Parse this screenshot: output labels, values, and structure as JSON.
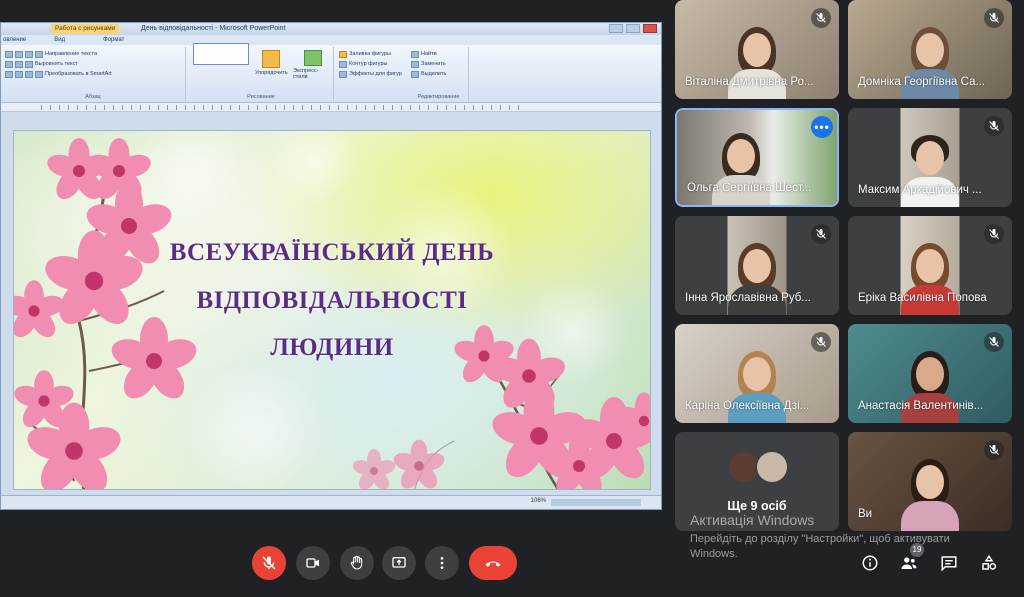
{
  "powerpoint": {
    "window_title": "День відповідальності - Microsoft PowerPoint",
    "context_tab": "Работа с рисунками",
    "tabs": [
      "овление",
      "Вид",
      "Формат"
    ],
    "ribbon": {
      "text_direction": "Направление текста",
      "align_text": "Выровнять текст",
      "smartart": "Преобразовать в SmartArt",
      "arrange": "Упорядочить",
      "quick_styles": "Экспресс-стили",
      "shape_fill": "Заливка фигуры",
      "shape_outline": "Контур фигуры",
      "shape_effects": "Эффекты для фигур",
      "find": "Найти",
      "replace": "Заменить",
      "select": "Выделить",
      "group_paragraph": "Абзац",
      "group_drawing": "Рисование",
      "group_editing": "Редактирование"
    },
    "zoom": "106%",
    "slide_lines": [
      "ВСЕУКРАЇНСЬКИЙ ДЕНЬ",
      "ВІДПОВІДАЛЬНОСТІ",
      "ЛЮДИНИ"
    ]
  },
  "participants": [
    {
      "name": "Віталіна Дмитрівна Ро...",
      "muted": true
    },
    {
      "name": "Домніка Георгіївна Са...",
      "muted": true
    },
    {
      "name": "Ольга Сергіївна Шест...",
      "muted": false,
      "active": true
    },
    {
      "name": "Максим Аркадійович ...",
      "muted": true
    },
    {
      "name": "Інна Ярославівна Руб...",
      "muted": true
    },
    {
      "name": "Еріка Василівна Попова",
      "muted": true
    },
    {
      "name": "Каріна Олексіївна Дзі...",
      "muted": true
    },
    {
      "name": "Анастасія Валентинів...",
      "muted": true
    },
    {
      "name": "Ви",
      "muted": true
    }
  ],
  "others_tile": {
    "label": "Ще 9 осіб"
  },
  "activation": {
    "title": "Активація Windows",
    "line1": "Перейдіть до розділу \"Настройки\", щоб активувати",
    "line2": "Windows."
  },
  "toolbar": {
    "mic": "mic-off-icon",
    "camera": "camera-icon",
    "raise_hand": "hand-icon",
    "present": "present-icon",
    "more": "more-vert-icon",
    "end_call": "end-call-icon"
  },
  "side_panel": {
    "people_count": "19"
  },
  "colors": {
    "meet_background": "#202124",
    "tile_background": "#3c4043",
    "danger": "#ea4335",
    "active_speaker": "#8ab4f8",
    "slide_title": "#5b2d82"
  }
}
